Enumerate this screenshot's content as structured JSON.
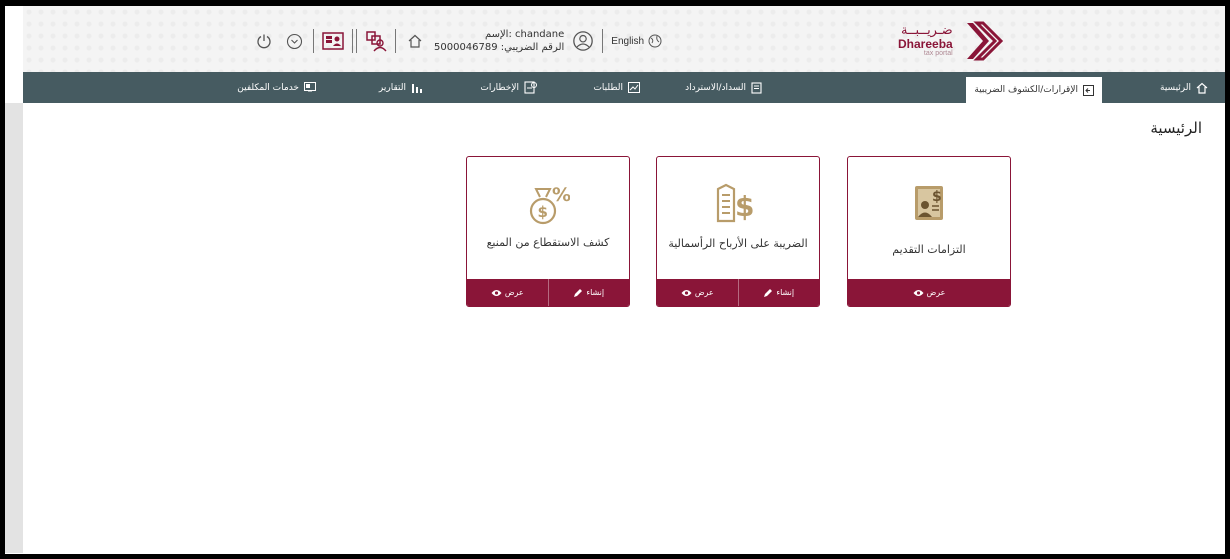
{
  "header": {
    "logo_ar": "ضـريــبــة",
    "logo_en": "Dhareeba",
    "logo_sub": "tax portal",
    "language": "English",
    "user_name_line": "الإسم: chandane",
    "tin_line": "الرقم الضريبي: 5000046789",
    "icons": [
      "power-icon",
      "chevron-down-circle-icon",
      "id-card-icon",
      "user-switch-icon",
      "home-icon",
      "user-circle-icon",
      "globe-icon"
    ]
  },
  "nav": {
    "home": "الرئيسية",
    "returns": "الإقرارات/الكشوف الضريبية",
    "payments": "السداد/الاسترداد",
    "requests": "الطلبات",
    "notifications": "الإخطارات",
    "reports": "التقارير",
    "taxpayer_services": "خدمات المكلفين"
  },
  "page": {
    "title": "الرئيسية"
  },
  "cards": {
    "filing": {
      "title": "التزامات التقديم",
      "view": "عرض"
    },
    "capital_gains": {
      "title": "الضريبة على الأرباح الرأسمالية",
      "create": "إنشاء",
      "view": "عرض"
    },
    "withholding": {
      "title": "كشف الاستقطاع من المنبع",
      "create": "إنشاء",
      "view": "عرض"
    }
  },
  "colors": {
    "brand": "#8a1538",
    "nav_bg": "#465b61",
    "gold": "#b89c6a"
  }
}
